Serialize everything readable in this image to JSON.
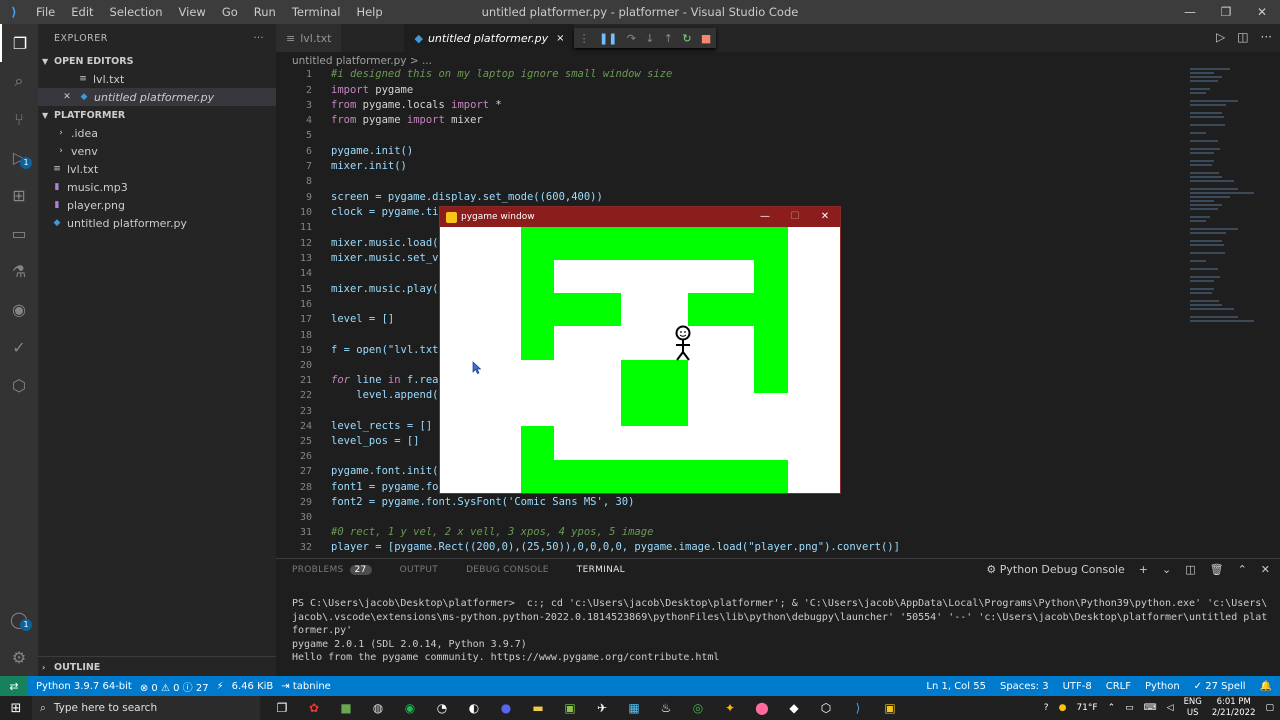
{
  "titlebar": {
    "menu": [
      "File",
      "Edit",
      "Selection",
      "View",
      "Go",
      "Run",
      "Terminal",
      "Help"
    ],
    "window_title": "untitled platformer.py - platformer - Visual Studio Code"
  },
  "activity": {
    "explorer_badge": "1",
    "accounts_badge": "1"
  },
  "sidebar": {
    "header": "EXPLORER",
    "open_editors_title": "OPEN EDITORS",
    "open_editors": [
      "lvl.txt",
      "untitled platformer.py"
    ],
    "project_title": "PLATFORMER",
    "files": [
      ".idea",
      "venv",
      "lvl.txt",
      "music.mp3",
      "player.png",
      "untitled platformer.py"
    ],
    "outline_title": "OUTLINE"
  },
  "tabs": [
    {
      "label": "lvl.txt"
    },
    {
      "label": "untitled platformer.py",
      "close": "×"
    }
  ],
  "breadcrumb": "untitled platformer.py > ...",
  "code": {
    "line_numbers": [
      "1",
      "2",
      "3",
      "4",
      "5",
      "6",
      "7",
      "8",
      "9",
      "10",
      "11",
      "12",
      "13",
      "14",
      "15",
      "16",
      "17",
      "18",
      "19",
      "20",
      "21",
      "22",
      "23",
      "24",
      "25",
      "26",
      "27",
      "28",
      "29",
      "30",
      "31",
      "32"
    ],
    "lines": {
      "l1": "#i designed this on my laptop ignore small window size",
      "l2_kw": "import",
      "l2_rest": " pygame",
      "l3_kw": "from",
      "l3_mid": " pygame.locals ",
      "l3_kw2": "import",
      "l3_rest": " *",
      "l4_kw": "from",
      "l4_mid": " pygame ",
      "l4_kw2": "import",
      "l4_rest": " mixer",
      "l6": "pygame.init()",
      "l7": "mixer.init()",
      "l9": "screen = pygame.display.set_mode((600,400))",
      "l10": "clock = pygame.tim",
      "l12": "mixer.music.load(\"",
      "l13": "mixer.music.set_vo",
      "l15": "mixer.music.play(-",
      "l17": "level = []",
      "l19": "f = open(\"lvl.txt\"",
      "l21_kw": "for",
      "l21_rest": " line ",
      "l21_kw2": "in",
      "l21_rest2": " f.read",
      "l22": "    level.append(li",
      "l24": "level_rects = []",
      "l25": "level_pos = []",
      "l27": "pygame.font.init()",
      "l28": "font1 = pygame.fon",
      "l29": "font2 = pygame.font.SysFont('Comic Sans MS', 30)",
      "l31": "#0 rect, 1 y vel, 2 x vell, 3 xpos, 4 ypos, 5 image",
      "l32": "player = [pygame.Rect((200,0),(25,50)),0,0,0,0, pygame.image.load(\"player.png\").convert()]"
    }
  },
  "panel": {
    "tabs": [
      "PROBLEMS",
      "OUTPUT",
      "DEBUG CONSOLE",
      "TERMINAL"
    ],
    "problems_count": "27",
    "console_select": "Python Debug Console",
    "terminal_lines": [
      "PS C:\\Users\\jacob\\Desktop\\platformer>  c:; cd 'c:\\Users\\jacob\\Desktop\\platformer'; & 'C:\\Users\\jacob\\AppData\\Local\\Programs\\Python\\Python39\\python.exe' 'c:\\Users\\",
      "jacob\\.vscode\\extensions\\ms-python.python-2022.0.1814523869\\pythonFiles\\lib\\python\\debugpy\\launcher' '50554' '--' 'c:\\Users\\jacob\\Desktop\\platformer\\untitled plat",
      "former.py'",
      "pygame 2.0.1 (SDL 2.0.14, Python 3.9.7)",
      "Hello from the pygame community. https://www.pygame.org/contribute.html"
    ]
  },
  "status": {
    "python": "Python 3.9.7 64-bit",
    "errors": "0",
    "warnings": "0",
    "info": "27",
    "size": "6.46 KiB",
    "tabnine": "tabnine",
    "position": "Ln 1, Col 55",
    "spaces": "Spaces: 3",
    "encoding": "UTF-8",
    "eol": "CRLF",
    "language": "Python",
    "spell": "27 Spell"
  },
  "pygame": {
    "title": "pygame window",
    "colors": {
      "wall": "#00ff00",
      "background": "#ffffff"
    }
  },
  "taskbar": {
    "search_placeholder": "Type here to search",
    "weather": "71°F",
    "lang": "ENG",
    "region": "US",
    "time": "6:01 PM",
    "date": "2/21/2022"
  }
}
